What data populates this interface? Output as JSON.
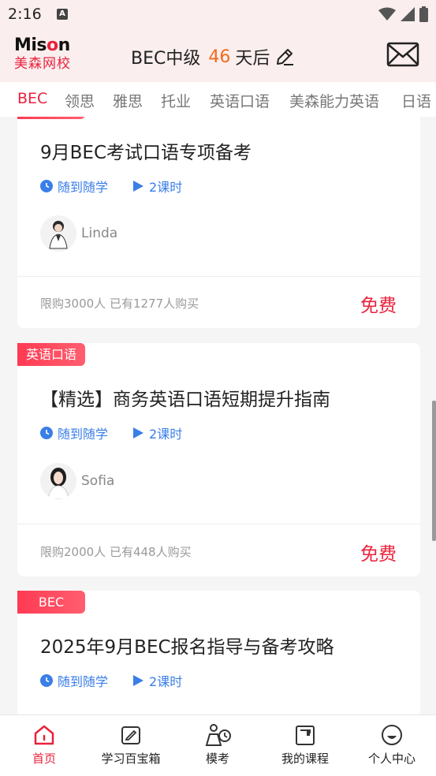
{
  "status_bar": {
    "time": "2:16",
    "notification_icon": "A"
  },
  "header": {
    "logo_top": "Mison",
    "logo_bottom": "美森网校",
    "exam_name": "BEC中级",
    "days": "46",
    "days_suffix": "天后",
    "icons": [
      "edit-icon",
      "mail-icon"
    ]
  },
  "tabs": [
    {
      "label": "BEC",
      "active": true
    },
    {
      "label": "领思"
    },
    {
      "label": "雅思"
    },
    {
      "label": "托业"
    },
    {
      "label": "英语口语"
    },
    {
      "label": "美森能力英语"
    },
    {
      "label": "日语"
    }
  ],
  "courses": [
    {
      "tag": "",
      "title": "9月BEC考试口语专项备考",
      "mode": "随到随学",
      "lessons": "2课时",
      "teacher": "Linda",
      "limit_text": "限购3000人 已有1277人购买",
      "price": "免费"
    },
    {
      "tag": "英语口语",
      "title": "【精选】商务英语口语短期提升指南",
      "mode": "随到随学",
      "lessons": "2课时",
      "teacher": "Sofia",
      "limit_text": "限购2000人 已有448人购买",
      "price": "免费"
    },
    {
      "tag": "BEC",
      "title": "2025年9月BEC报名指导与备考攻略",
      "mode": "随到随学",
      "lessons": "2课时"
    }
  ],
  "bottom_nav": [
    {
      "label": "首页",
      "icon": "home-icon",
      "active": true
    },
    {
      "label": "学习百宝箱",
      "icon": "toolbox-icon"
    },
    {
      "label": "模考",
      "icon": "mock-exam-icon"
    },
    {
      "label": "我的课程",
      "icon": "my-courses-icon"
    },
    {
      "label": "个人中心",
      "icon": "profile-icon"
    }
  ],
  "colors": {
    "accent": "#e8233d",
    "days": "#f26b1d",
    "meta_blue": "#3a7ee8",
    "header_bg": "#fbeeee"
  }
}
